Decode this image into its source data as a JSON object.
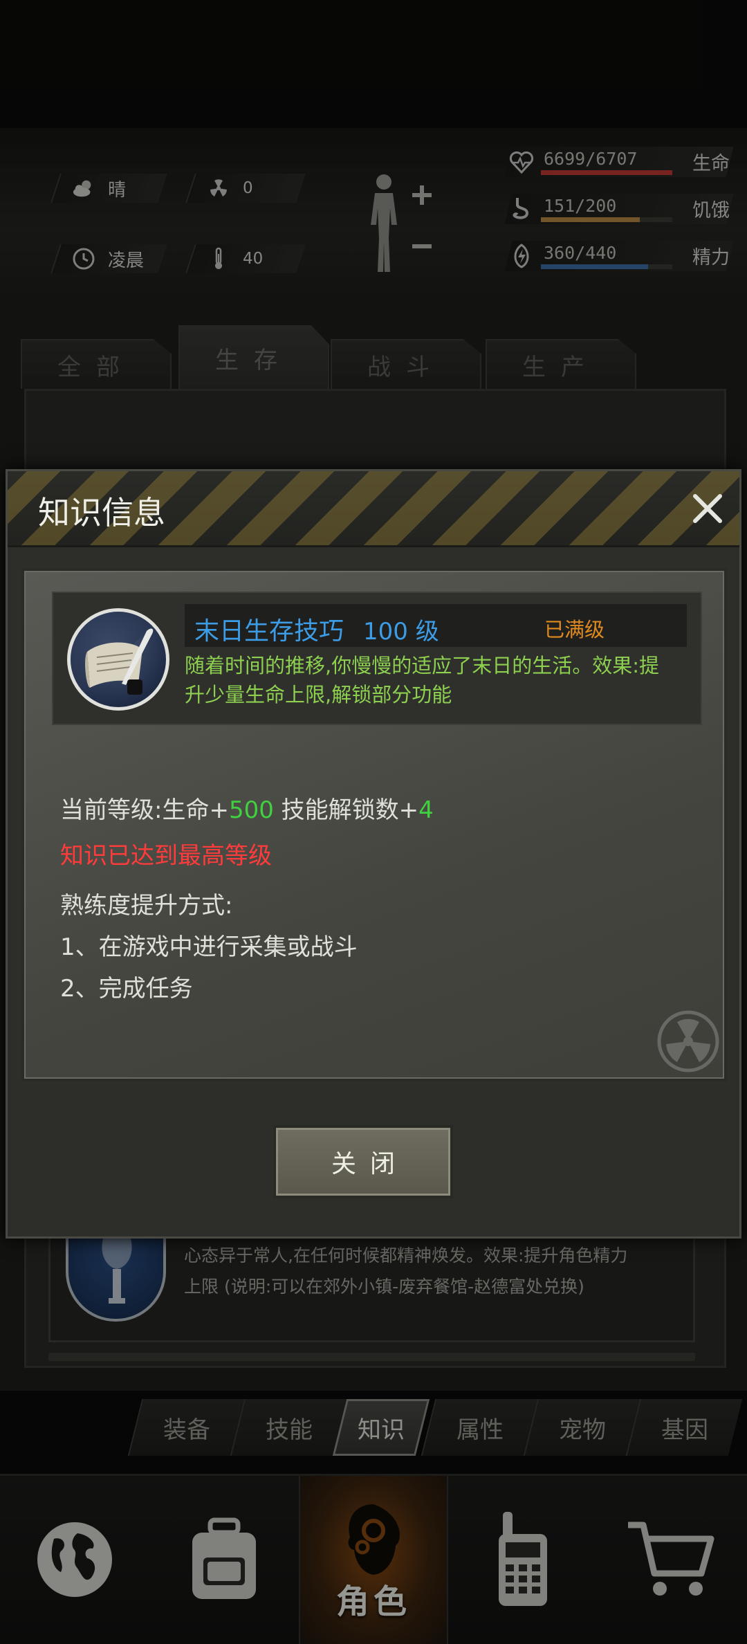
{
  "status": {
    "weather": {
      "icon": "cloud-sun-icon",
      "label": "晴"
    },
    "radiation": {
      "icon": "radiation-icon",
      "value": "0"
    },
    "time": {
      "icon": "clock-icon",
      "label": "凌晨"
    },
    "temperature": {
      "icon": "thermometer-icon",
      "value": "40"
    },
    "body_icon": "body-figure-plus-minus-icon",
    "bars": [
      {
        "key": "life",
        "icon": "heart-pulse-icon",
        "value": "6699/6707",
        "label": "生命",
        "fill": 0.999,
        "color": "#c13a34"
      },
      {
        "key": "hunger",
        "icon": "stomach-icon",
        "value": "151/200",
        "label": "饥饿",
        "fill": 0.755,
        "color": "#b88a44"
      },
      {
        "key": "energy",
        "icon": "energy-icon",
        "value": "360/440",
        "label": "精力",
        "fill": 0.818,
        "color": "#3d6fa6"
      }
    ]
  },
  "top_tabs": [
    {
      "label": "全部",
      "active": false
    },
    {
      "label": "生存",
      "active": true
    },
    {
      "label": "战斗",
      "active": false
    },
    {
      "label": "生产",
      "active": false
    }
  ],
  "background_item": {
    "desc_line1": "心态异于常人,在任何时候都精神焕发。效果:提升角色精力",
    "desc_line2": "上限 (说明:可以在郊外小镇-废弃餐馆-赵德富处兑换)"
  },
  "sub_nav": [
    {
      "label": "装备",
      "active": false
    },
    {
      "label": "技能",
      "active": false
    },
    {
      "label": "知识",
      "active": true
    },
    {
      "label": "属性",
      "active": false
    },
    {
      "label": "宠物",
      "active": false
    },
    {
      "label": "基因",
      "active": false
    }
  ],
  "main_nav": [
    {
      "icon": "globe-icon",
      "label": "",
      "active": false
    },
    {
      "icon": "backpack-icon",
      "label": "",
      "active": false
    },
    {
      "icon": "character-head-icon",
      "label": "角色",
      "active": true
    },
    {
      "icon": "walkie-talkie-icon",
      "label": "",
      "active": false
    },
    {
      "icon": "shopping-cart-icon",
      "label": "",
      "active": false
    }
  ],
  "modal": {
    "title": "知识信息",
    "skill": {
      "icon": "scroll-quill-icon",
      "name": "末日生存技巧",
      "level": "100 级",
      "max_label": "已满级",
      "desc_line1": "随着时间的推移,你慢慢的适应了末日的生活。效果:提",
      "desc_line2": "升少量生命上限,解锁部分功能"
    },
    "current_level": {
      "prefix": "当前等级:生命+",
      "life_bonus": "500",
      "mid": " 技能解锁数+",
      "unlock_bonus": "4"
    },
    "max_notice": "知识已达到最高等级",
    "method_title": "熟练度提升方式:",
    "methods": [
      "1、在游戏中进行采集或战斗",
      "2、完成任务"
    ],
    "close_button": "关闭",
    "colors": {
      "accent_blue": "#3c9ce6",
      "desc_green": "#8dd050",
      "max_orange": "#e08a20",
      "warning_red": "#ff3b3b",
      "bonus_green": "#40d040"
    }
  }
}
